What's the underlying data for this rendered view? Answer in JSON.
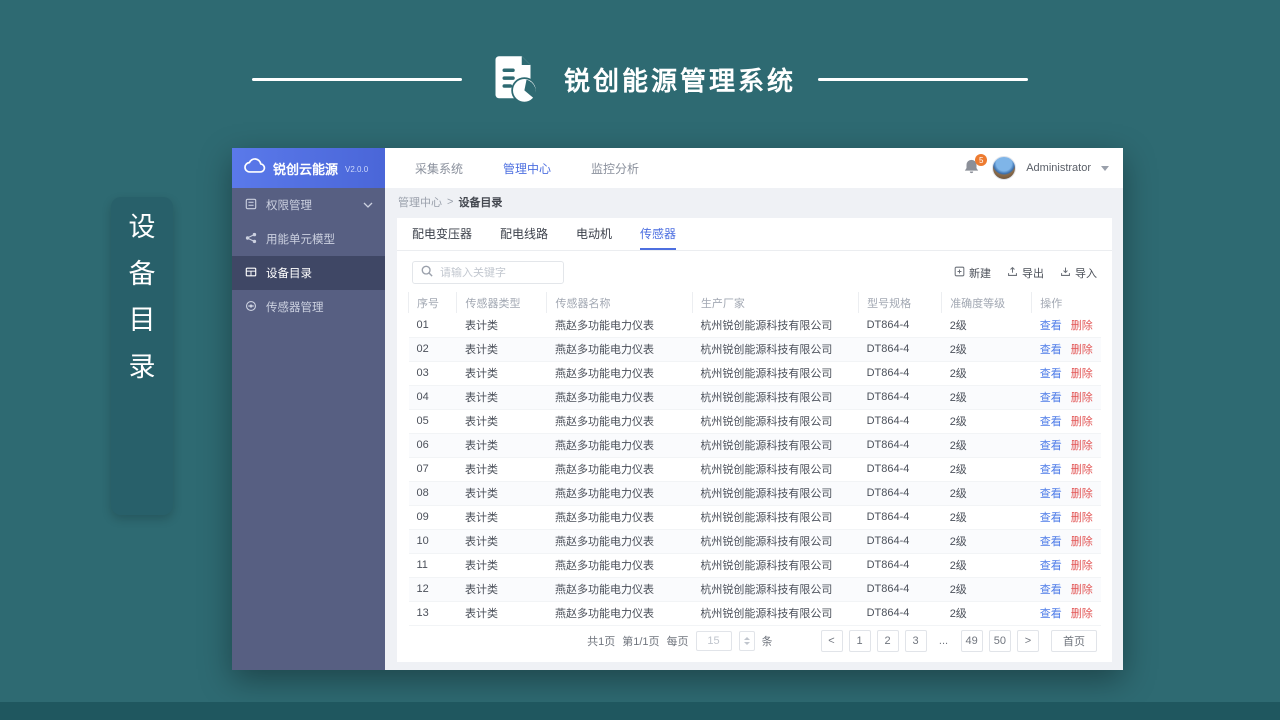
{
  "hero": {
    "title": "锐创能源管理系统",
    "side_label": [
      "设",
      "备",
      "目",
      "录"
    ]
  },
  "window": {
    "brand": {
      "name": "锐创云能源",
      "version": "V2.0.0"
    },
    "topnav": [
      {
        "label": "采集系统",
        "active": false
      },
      {
        "label": "管理中心",
        "active": true
      },
      {
        "label": "监控分析",
        "active": false
      }
    ],
    "user": {
      "name": "Administrator",
      "badge": "5"
    },
    "sidebar": [
      {
        "label": "权限管理",
        "icon": "list-icon",
        "active": false,
        "chevron": true
      },
      {
        "label": "用能单元模型",
        "icon": "share-icon",
        "active": false,
        "chevron": false
      },
      {
        "label": "设备目录",
        "icon": "grid-icon",
        "active": true,
        "chevron": false
      },
      {
        "label": "传感器管理",
        "icon": "sensor-icon",
        "active": false,
        "chevron": false
      }
    ],
    "breadcrumb": {
      "parent": "管理中心",
      "separator": ">",
      "current": "设备目录"
    },
    "tabs": [
      {
        "label": "配电变压器",
        "active": false
      },
      {
        "label": "配电线路",
        "active": false
      },
      {
        "label": "电动机",
        "active": false
      },
      {
        "label": "传感器",
        "active": true
      }
    ],
    "search": {
      "placeholder": "请输入关键字"
    },
    "toolbar": [
      {
        "label": "新建",
        "icon": "new-icon"
      },
      {
        "label": "导出",
        "icon": "export-icon"
      },
      {
        "label": "导入",
        "icon": "import-icon"
      }
    ],
    "table": {
      "headers": [
        "序号",
        "传感器类型",
        "传感器名称",
        "生产厂家",
        "型号规格",
        "准确度等级",
        "操作"
      ],
      "actions": {
        "view": "查看",
        "delete": "删除"
      },
      "rows": [
        {
          "no": "01",
          "type": "表计类",
          "name": "燕赵多功能电力仪表",
          "vendor": "杭州锐创能源科技有限公司",
          "model": "DT864-4",
          "grade": "2级"
        },
        {
          "no": "02",
          "type": "表计类",
          "name": "燕赵多功能电力仪表",
          "vendor": "杭州锐创能源科技有限公司",
          "model": "DT864-4",
          "grade": "2级"
        },
        {
          "no": "03",
          "type": "表计类",
          "name": "燕赵多功能电力仪表",
          "vendor": "杭州锐创能源科技有限公司",
          "model": "DT864-4",
          "grade": "2级"
        },
        {
          "no": "04",
          "type": "表计类",
          "name": "燕赵多功能电力仪表",
          "vendor": "杭州锐创能源科技有限公司",
          "model": "DT864-4",
          "grade": "2级"
        },
        {
          "no": "05",
          "type": "表计类",
          "name": "燕赵多功能电力仪表",
          "vendor": "杭州锐创能源科技有限公司",
          "model": "DT864-4",
          "grade": "2级"
        },
        {
          "no": "06",
          "type": "表计类",
          "name": "燕赵多功能电力仪表",
          "vendor": "杭州锐创能源科技有限公司",
          "model": "DT864-4",
          "grade": "2级"
        },
        {
          "no": "07",
          "type": "表计类",
          "name": "燕赵多功能电力仪表",
          "vendor": "杭州锐创能源科技有限公司",
          "model": "DT864-4",
          "grade": "2级"
        },
        {
          "no": "08",
          "type": "表计类",
          "name": "燕赵多功能电力仪表",
          "vendor": "杭州锐创能源科技有限公司",
          "model": "DT864-4",
          "grade": "2级"
        },
        {
          "no": "09",
          "type": "表计类",
          "name": "燕赵多功能电力仪表",
          "vendor": "杭州锐创能源科技有限公司",
          "model": "DT864-4",
          "grade": "2级"
        },
        {
          "no": "10",
          "type": "表计类",
          "name": "燕赵多功能电力仪表",
          "vendor": "杭州锐创能源科技有限公司",
          "model": "DT864-4",
          "grade": "2级"
        },
        {
          "no": "11",
          "type": "表计类",
          "name": "燕赵多功能电力仪表",
          "vendor": "杭州锐创能源科技有限公司",
          "model": "DT864-4",
          "grade": "2级"
        },
        {
          "no": "12",
          "type": "表计类",
          "name": "燕赵多功能电力仪表",
          "vendor": "杭州锐创能源科技有限公司",
          "model": "DT864-4",
          "grade": "2级"
        },
        {
          "no": "13",
          "type": "表计类",
          "name": "燕赵多功能电力仪表",
          "vendor": "杭州锐创能源科技有限公司",
          "model": "DT864-4",
          "grade": "2级"
        }
      ]
    },
    "pagination": {
      "total_pages": "共1页",
      "current_page": "第1/1页",
      "per_page_label": "每页",
      "per_page_value": "15",
      "unit": "条",
      "prev": "<",
      "next": ">",
      "pages": [
        "1",
        "2",
        "3",
        "...",
        "49",
        "50"
      ],
      "home": "首页"
    }
  },
  "colors": {
    "background": "#2e6a72",
    "accent_blue": "#4d6fe0",
    "sidebar": "#575f82",
    "link_view": "#4e7ce8",
    "link_delete": "#e25454",
    "badge": "#ed7b30"
  }
}
